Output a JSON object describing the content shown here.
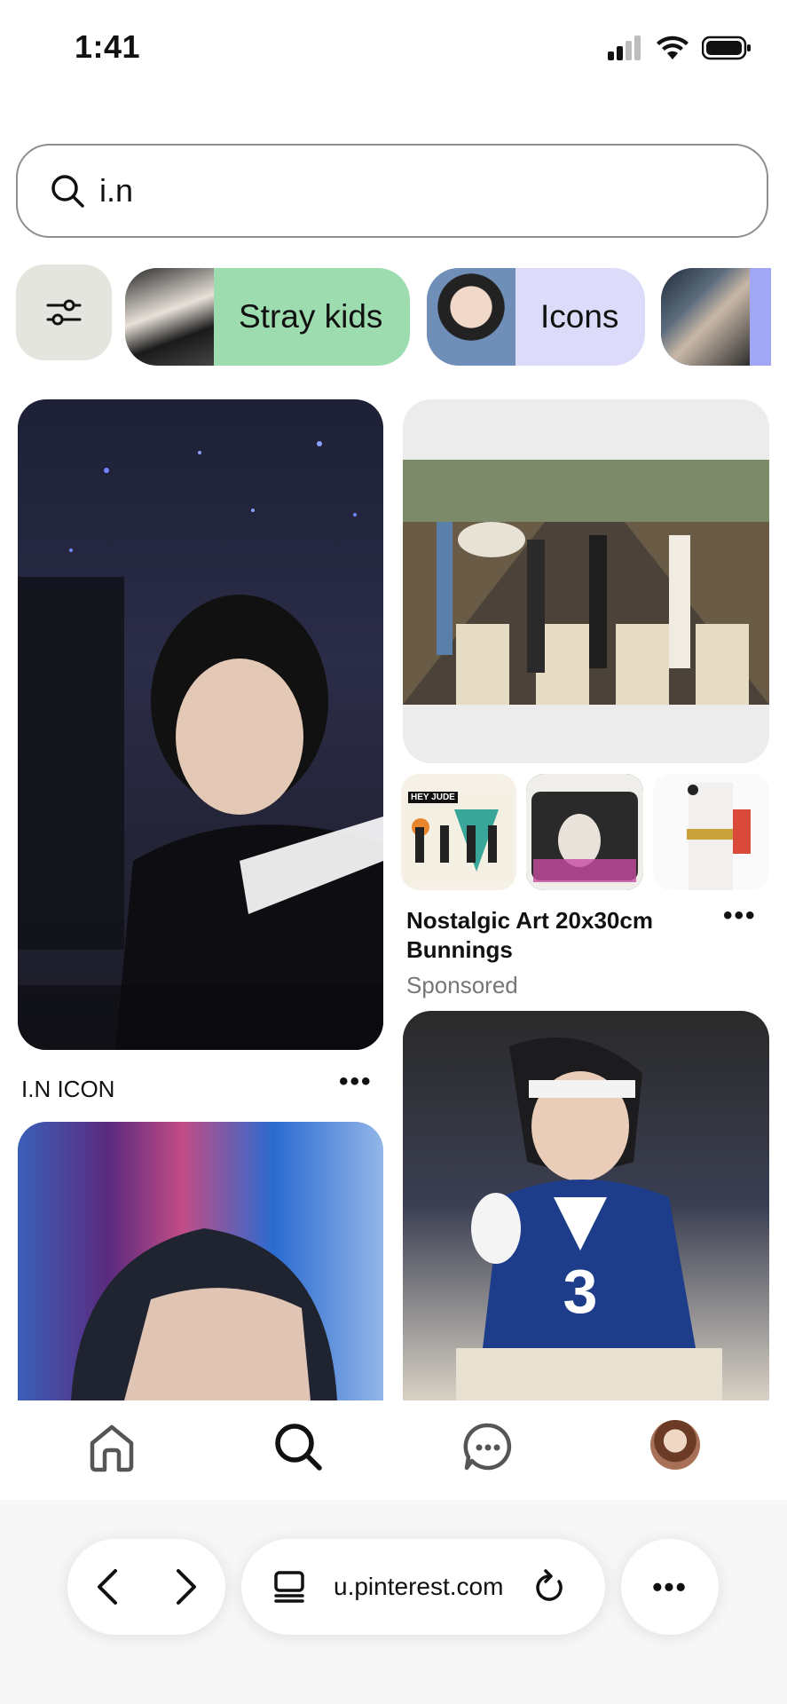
{
  "status_bar": {
    "time": "1:41"
  },
  "search": {
    "value": "i.n",
    "icon": "search-icon"
  },
  "chips": [
    {
      "label": "Stray kids",
      "color": "#9ddcae"
    },
    {
      "label": "Icons",
      "color": "#dcdcfa"
    },
    {
      "label": "",
      "color": "#a2a7f5"
    }
  ],
  "pins": {
    "left_first": {
      "title": "I.N ICON",
      "more": "•••"
    },
    "right_ad": {
      "title_line1": "Nostalgic Art 20x30cm",
      "title_line2": "Bunnings",
      "sponsored": "Sponsored",
      "more": "•••",
      "thumb_text": "HEY JUDE"
    }
  },
  "bottom_nav": {
    "items": [
      "home-icon",
      "search-icon",
      "messages-icon",
      "profile-avatar"
    ],
    "active": "search-icon"
  },
  "browser": {
    "url": "u.pinterest.com",
    "more": "•••"
  },
  "colors": {
    "accent_green": "#9ddcae",
    "accent_purple": "#dcdcfa",
    "chip_gray": "#e5e5e0"
  }
}
